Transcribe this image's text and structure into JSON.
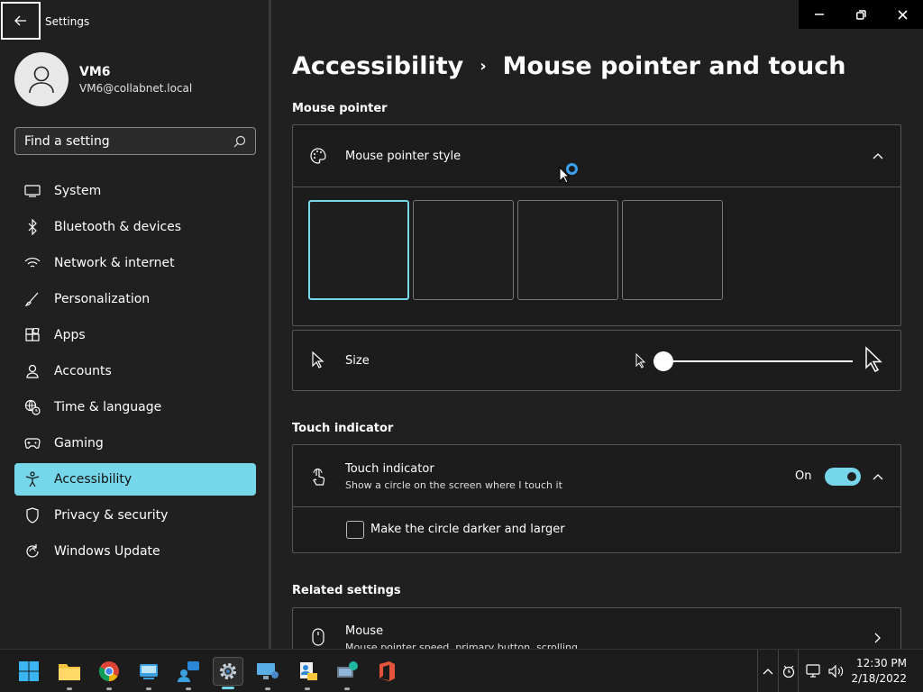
{
  "app": {
    "title": "Settings"
  },
  "user": {
    "name": "VM6",
    "email": "VM6@collabnet.local"
  },
  "search": {
    "placeholder": "Find a setting"
  },
  "nav": [
    {
      "label": "System",
      "icon": "monitor-icon"
    },
    {
      "label": "Bluetooth & devices",
      "icon": "bluetooth-icon"
    },
    {
      "label": "Network & internet",
      "icon": "wifi-icon"
    },
    {
      "label": "Personalization",
      "icon": "brush-icon"
    },
    {
      "label": "Apps",
      "icon": "apps-icon"
    },
    {
      "label": "Accounts",
      "icon": "person-icon"
    },
    {
      "label": "Time & language",
      "icon": "globe-clock-icon"
    },
    {
      "label": "Gaming",
      "icon": "gamepad-icon"
    },
    {
      "label": "Accessibility",
      "icon": "accessibility-icon",
      "active": true
    },
    {
      "label": "Privacy & security",
      "icon": "shield-icon"
    },
    {
      "label": "Windows Update",
      "icon": "update-icon"
    }
  ],
  "breadcrumb": {
    "parent": "Accessibility",
    "separator": "›",
    "current": "Mouse pointer and touch"
  },
  "mouse_pointer": {
    "section_label": "Mouse pointer",
    "style_title": "Mouse pointer style",
    "style_selected_index": 0,
    "size_title": "Size",
    "size_value": 0
  },
  "touch": {
    "section_label": "Touch indicator",
    "title": "Touch indicator",
    "subtitle": "Show a circle on the screen where I touch it",
    "state_label": "On",
    "darker_label": "Make the circle darker and larger"
  },
  "related": {
    "section_label": "Related settings",
    "mouse_title": "Mouse",
    "mouse_subtitle": "Mouse pointer speed, primary button, scrolling"
  },
  "clock": {
    "time": "12:30 PM",
    "date": "2/18/2022"
  },
  "colors": {
    "accent": "#76d6ea",
    "background": "#202020"
  }
}
